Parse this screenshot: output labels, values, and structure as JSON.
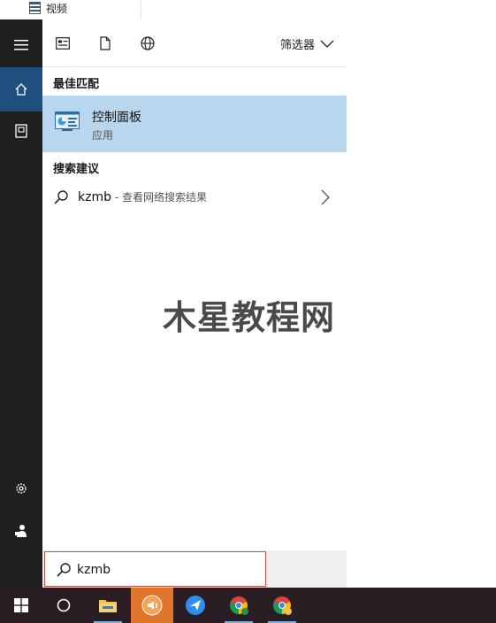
{
  "top_strip": {
    "item_label": "视频"
  },
  "filters": {
    "filter_button_label": "筛选器"
  },
  "best_match": {
    "section_label": "最佳匹配",
    "title": "控制面板",
    "subtitle": "应用"
  },
  "suggestions": {
    "section_label": "搜索建议",
    "query": "kzmb",
    "hint": " - 查看网络搜索结果"
  },
  "watermark": "木星教程网",
  "search": {
    "value": "kzmb"
  },
  "colors": {
    "rail": "#1f1f1f",
    "rail_active": "#1e4f7d",
    "selection": "#b8d6ee",
    "taskbar": "#2a1d24",
    "taskbar_active": "#e0762b",
    "searchbox_border": "#d94b3f"
  }
}
